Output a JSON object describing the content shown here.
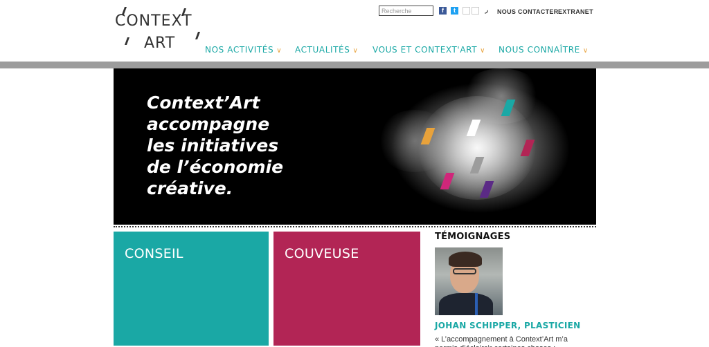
{
  "logo": {
    "line1": "CONTEXT",
    "line2": "ART"
  },
  "search": {
    "placeholder": "Recherche"
  },
  "social": {
    "facebook_glyph": "f",
    "twitter_glyph": "t",
    "rss_glyph": "◞",
    "icons": [
      "facebook-icon",
      "twitter-icon",
      "google-plus-icon",
      "linkedin-icon",
      "rss-icon"
    ]
  },
  "toplinks": {
    "contact": "NOUS CONTACTER",
    "extranet": "EXTRANET"
  },
  "nav": {
    "items": [
      {
        "label": "NOS ACTIVITÉS"
      },
      {
        "label": "ACTUALITÉS"
      },
      {
        "label": "VOUS ET CONTEXT'ART"
      },
      {
        "label": "NOUS CONNAÎTRE"
      }
    ],
    "chevron": "∨"
  },
  "banner": {
    "line1": "Context’Art",
    "line2": "accompagne",
    "line3": "les initiatives",
    "line4": "de l’économie",
    "line5": "créative."
  },
  "cards": {
    "conseil": "CONSEIL",
    "couveuse": "COUVEUSE"
  },
  "testimonials": {
    "heading": "TÉMOIGNAGES",
    "name": "JOHAN SCHIPPER, PLASTICIEN",
    "quote": "« L’accompagnement à Context’Art m’a permis d’éclaircir certaines choses :"
  },
  "colors": {
    "teal": "#1aa8a5",
    "crimson": "#b22555",
    "orange": "#e8a23b",
    "purple": "#5b2a86",
    "gray_bar": "#9c9c9c"
  }
}
